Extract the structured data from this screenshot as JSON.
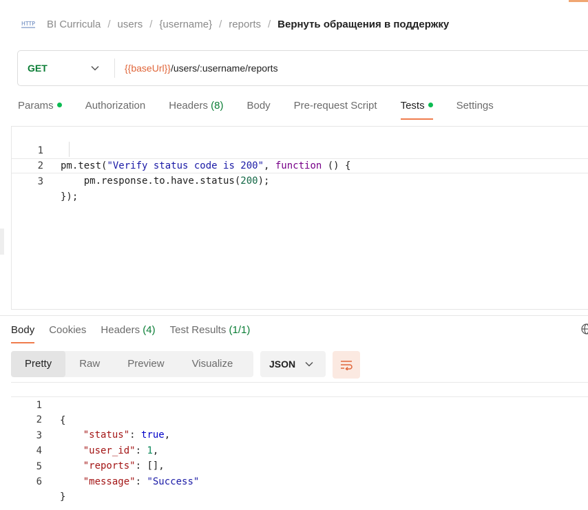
{
  "breadcrumb": {
    "icon": "http-icon",
    "items": [
      "BI Curricula",
      "users",
      "{username}",
      "reports"
    ],
    "separator": "/",
    "current": "Вернуть обращения в поддержку"
  },
  "request": {
    "method": "GET",
    "url_variable": "{{baseUrl}}",
    "url_path": "/users/:username/reports"
  },
  "request_tabs": [
    {
      "label": "Params",
      "dot": true,
      "count": "",
      "active": false
    },
    {
      "label": "Authorization",
      "dot": false,
      "count": "",
      "active": false
    },
    {
      "label": "Headers",
      "dot": false,
      "count": "(8)",
      "active": false
    },
    {
      "label": "Body",
      "dot": false,
      "count": "",
      "active": false
    },
    {
      "label": "Pre-request Script",
      "dot": false,
      "count": "",
      "active": false
    },
    {
      "label": "Tests",
      "dot": true,
      "count": "",
      "active": true
    },
    {
      "label": "Settings",
      "dot": false,
      "count": "",
      "active": false
    }
  ],
  "tests_editor": {
    "line_numbers": [
      "1",
      "2",
      "3"
    ],
    "line1": {
      "a": "pm.test(",
      "b": "\"Verify status code is 200\"",
      "c": ", ",
      "d": "function",
      "e": " () {"
    },
    "line2": {
      "a": "    pm.response.to.have.status(",
      "b": "200",
      "c": ");"
    },
    "line3": {
      "a": "});"
    }
  },
  "response_tabs": [
    {
      "label": "Body",
      "count": "",
      "active": true
    },
    {
      "label": "Cookies",
      "count": "",
      "active": false
    },
    {
      "label": "Headers",
      "count": "(4)",
      "active": false
    },
    {
      "label": "Test Results",
      "count": "(1/1)",
      "active": false
    }
  ],
  "view_modes": [
    "Pretty",
    "Raw",
    "Preview",
    "Visualize"
  ],
  "active_view_mode": "Pretty",
  "format_select": "JSON",
  "response_body": {
    "line_numbers": [
      "1",
      "2",
      "3",
      "4",
      "5",
      "6"
    ],
    "open": "{",
    "close": "}",
    "fields": [
      {
        "key": "\"status\"",
        "value": "true",
        "type": "bool",
        "trail": ","
      },
      {
        "key": "\"user_id\"",
        "value": "1",
        "type": "num",
        "trail": ","
      },
      {
        "key": "\"reports\"",
        "value": "[]",
        "type": "plain",
        "trail": ","
      },
      {
        "key": "\"message\"",
        "value": "\"Success\"",
        "type": "str",
        "trail": ""
      }
    ]
  },
  "colors": {
    "accent": "#ef7b4c",
    "method_get": "#0a7d35",
    "url_variable": "#e0663a",
    "status_dot": "#0cbb52"
  }
}
